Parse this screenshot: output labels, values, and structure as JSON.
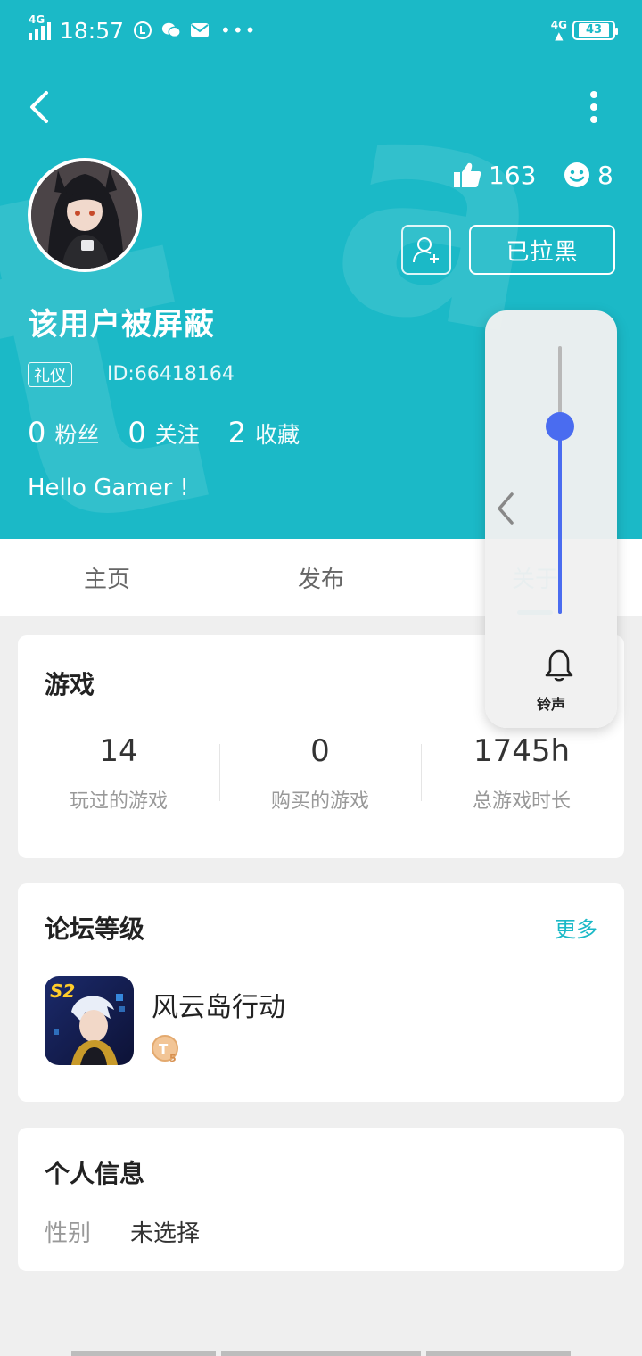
{
  "status_bar": {
    "network_left": "4G",
    "time": "18:57",
    "more_dots": "•••",
    "network_right": "4G",
    "battery": "43"
  },
  "header": {
    "watermark": "tapTap",
    "likes": "163",
    "smiles": "8",
    "blocked_label": "已拉黑",
    "username": "该用户被屏蔽",
    "badge": "礼仪",
    "user_id": "ID:66418164",
    "stats": [
      {
        "num": "0",
        "label": "粉丝"
      },
      {
        "num": "0",
        "label": "关注"
      },
      {
        "num": "2",
        "label": "收藏"
      }
    ],
    "bio": "Hello Gamer !"
  },
  "tabs": [
    "主页",
    "发布",
    "关于"
  ],
  "games_card": {
    "title": "游戏",
    "stats": [
      {
        "value": "14",
        "label": "玩过的游戏"
      },
      {
        "value": "0",
        "label": "购买的游戏"
      },
      {
        "value": "1745h",
        "label": "总游戏时长"
      }
    ]
  },
  "forum_card": {
    "title": "论坛等级",
    "more": "更多",
    "game_name": "风云岛行动",
    "level_icon": "T5-level-badge"
  },
  "info_card": {
    "title": "个人信息",
    "gender_key": "性别",
    "gender_value": "未选择"
  },
  "volume_panel": {
    "label": "铃声",
    "level": 0.7,
    "accent": "#4a6cf0"
  },
  "colors": {
    "brand": "#1bb9c7"
  }
}
